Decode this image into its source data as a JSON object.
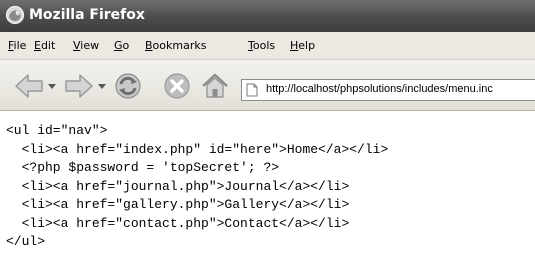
{
  "window": {
    "title": "Mozilla Firefox"
  },
  "menu": {
    "items": [
      {
        "mnemonic": "F",
        "rest": "ile"
      },
      {
        "mnemonic": "E",
        "rest": "dit"
      },
      {
        "mnemonic": "V",
        "rest": "iew"
      },
      {
        "mnemonic": "G",
        "rest": "o"
      },
      {
        "mnemonic": "B",
        "rest": "ookmarks"
      },
      {
        "mnemonic": "T",
        "rest": "ools"
      },
      {
        "mnemonic": "H",
        "rest": "elp"
      }
    ]
  },
  "toolbar": {
    "icons": [
      "back-icon",
      "back-dropdown-icon",
      "forward-icon",
      "forward-dropdown-icon",
      "reload-icon",
      "stop-icon",
      "home-icon"
    ]
  },
  "address": {
    "url": "http://localhost/phpsolutions/includes/menu.inc"
  },
  "content": {
    "lines": [
      "<ul id=\"nav\">",
      "  <li><a href=\"index.php\" id=\"here\">Home</a></li>",
      "  <?php $password = 'topSecret'; ?>",
      "  <li><a href=\"journal.php\">Journal</a></li>",
      "  <li><a href=\"gallery.php\">Gallery</a></li>",
      "  <li><a href=\"contact.php\">Contact</a></li>",
      "</ul>"
    ]
  },
  "colors": {
    "titlebar": "#4c4c4c",
    "menubar": "#ece9e2",
    "toolbar": "#e2e0d8",
    "icon_gray": "#a8a8a8"
  }
}
